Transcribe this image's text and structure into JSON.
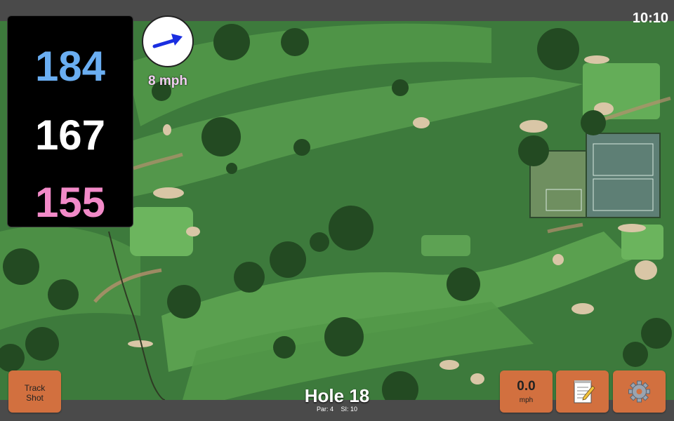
{
  "status": {
    "time": "10:10"
  },
  "distances": {
    "back": "184",
    "middle": "167",
    "front": "155",
    "back_color": "#6aaef2",
    "middle_color": "#ffffff",
    "front_color": "#f28ac8"
  },
  "wind": {
    "speed": "8 mph",
    "icon": "wind-arrow-icon",
    "arrow_color": "#1a2ee0"
  },
  "buttons": {
    "track_shot": {
      "line1": "Track",
      "line2": "Shot"
    },
    "speed": {
      "value": "0.0",
      "unit": "mph"
    },
    "notes": {
      "icon": "notepad-icon"
    },
    "settings": {
      "icon": "gear-icon"
    },
    "color": "#d2703f"
  },
  "hole": {
    "title": "Hole 18",
    "par": "Par: 4",
    "si": "SI: 10"
  },
  "map": {
    "type": "satellite-golf-course"
  }
}
